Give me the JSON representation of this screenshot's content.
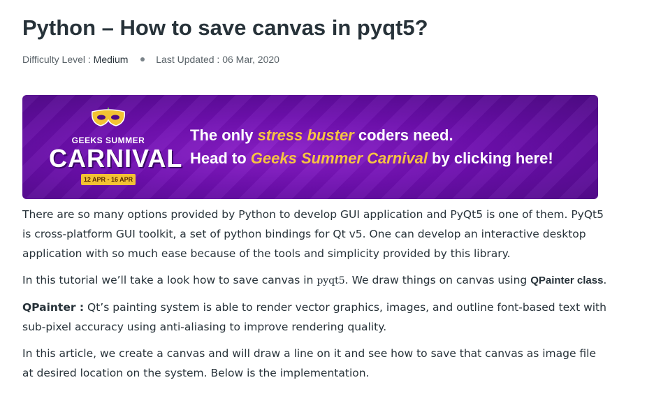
{
  "article": {
    "title": "Python – How to save canvas in pyqt5?",
    "difficulty_label": "Difficulty Level :",
    "difficulty_value": "Medium",
    "updated_label": "Last Updated :",
    "updated_value": "06 Mar, 2020"
  },
  "banner": {
    "logo_small": "GEEKS SUMMER",
    "logo_big": "CARNIVAL",
    "logo_dates": "12 APR - 16 APR",
    "line1_pre": "The only ",
    "line1_hl": "stress buster",
    "line1_post": " coders need.",
    "line2_pre": "Head to ",
    "line2_hl": "Geeks Summer Carnival",
    "line2_post": " by clicking here!",
    "colors": {
      "background": "#6d0fae",
      "highlight": "#f6c342"
    }
  },
  "body": {
    "p1": "There are so many options provided by Python to develop GUI application and PyQt5 is one of them. PyQt5 is cross-platform GUI toolkit, a set of python bindings for Qt v5. One can develop an interactive desktop application with so much ease because of the tools and simplicity provided by this library.",
    "p2_pre": "In this tutorial we’ll take a look how to save canvas in ",
    "p2_code": "pyqt5",
    "p2_mid": ". We draw things on canvas using ",
    "p2_link": "QPainter class",
    "p2_post": ".",
    "p3_strong": "QPainter :",
    "p3_text": " Qt’s painting system is able to render vector graphics, images, and outline font-based text with sub-pixel accuracy using anti-aliasing to improve rendering quality.",
    "p4": "In this article, we create a canvas and will draw a line on it and see how to save that canvas as image file at desired location on the system. Below is the implementation."
  }
}
